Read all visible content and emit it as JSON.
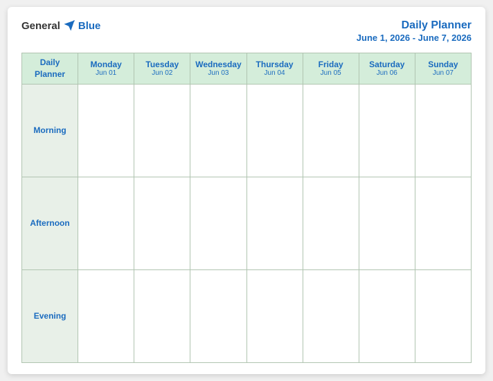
{
  "header": {
    "logo_general": "General",
    "logo_blue": "Blue",
    "title": "Daily Planner",
    "subtitle": "June 1, 2026 - June 7, 2026"
  },
  "table": {
    "header_col": {
      "line1": "Daily",
      "line2": "Planner"
    },
    "days": [
      {
        "name": "Monday",
        "date": "Jun 01"
      },
      {
        "name": "Tuesday",
        "date": "Jun 02"
      },
      {
        "name": "Wednesday",
        "date": "Jun 03"
      },
      {
        "name": "Thursday",
        "date": "Jun 04"
      },
      {
        "name": "Friday",
        "date": "Jun 05"
      },
      {
        "name": "Saturday",
        "date": "Jun 06"
      },
      {
        "name": "Sunday",
        "date": "Jun 07"
      }
    ],
    "rows": [
      {
        "label": "Morning"
      },
      {
        "label": "Afternoon"
      },
      {
        "label": "Evening"
      }
    ]
  }
}
